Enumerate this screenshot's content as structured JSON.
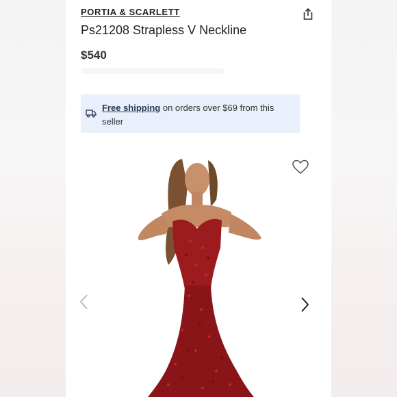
{
  "listing": {
    "brand": "PORTIA & SCARLETT",
    "title": "Ps21208 Strapless V Neckline",
    "price": "$540"
  },
  "shipping_banner": {
    "link_label": "Free shipping",
    "text": " on orders over $69 from this seller"
  },
  "image": {
    "description_icon": "dress-photo"
  },
  "colors": {
    "accent": "#e9f0fb",
    "dress": "#9b1b1f"
  }
}
